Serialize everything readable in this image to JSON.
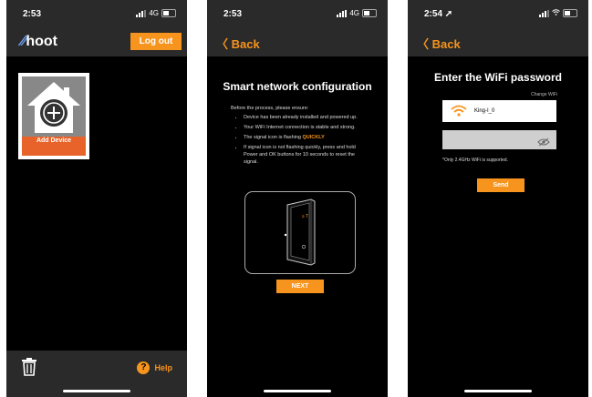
{
  "screens": {
    "home": {
      "time": "2:53",
      "network": "4G",
      "logo_text": "hoot",
      "logout_label": "Log out",
      "add_device_label": "Add Device",
      "help_label": "Help"
    },
    "config": {
      "time": "2:53",
      "network": "4G",
      "back_label": "Back",
      "title": "Smart network configuration",
      "intro": "Before the process, please ensure:",
      "steps": [
        "Device has been already installed and powered up.",
        "Your WiFi Internet connection is stable and strong.",
        "The signal icon is flashing",
        "If signal icon is not flashing quickly, press and hold Power and OK buttons for 10 seconds to reset the signal."
      ],
      "highlight": "QUICKLY",
      "next_label": "NEXT"
    },
    "wifi": {
      "time": "2:54",
      "back_label": "Back",
      "title": "Enter the WiFi password",
      "change_wifi": "Change WiFi",
      "ssid": "King-I_0",
      "password_value": "",
      "note": "*Only 2.4GHz WiFi is supported.",
      "send_label": "Send"
    }
  },
  "colors": {
    "accent": "#f7941d",
    "tile_label": "#e8632a",
    "bar": "#2a2a2a",
    "background": "#000000"
  }
}
